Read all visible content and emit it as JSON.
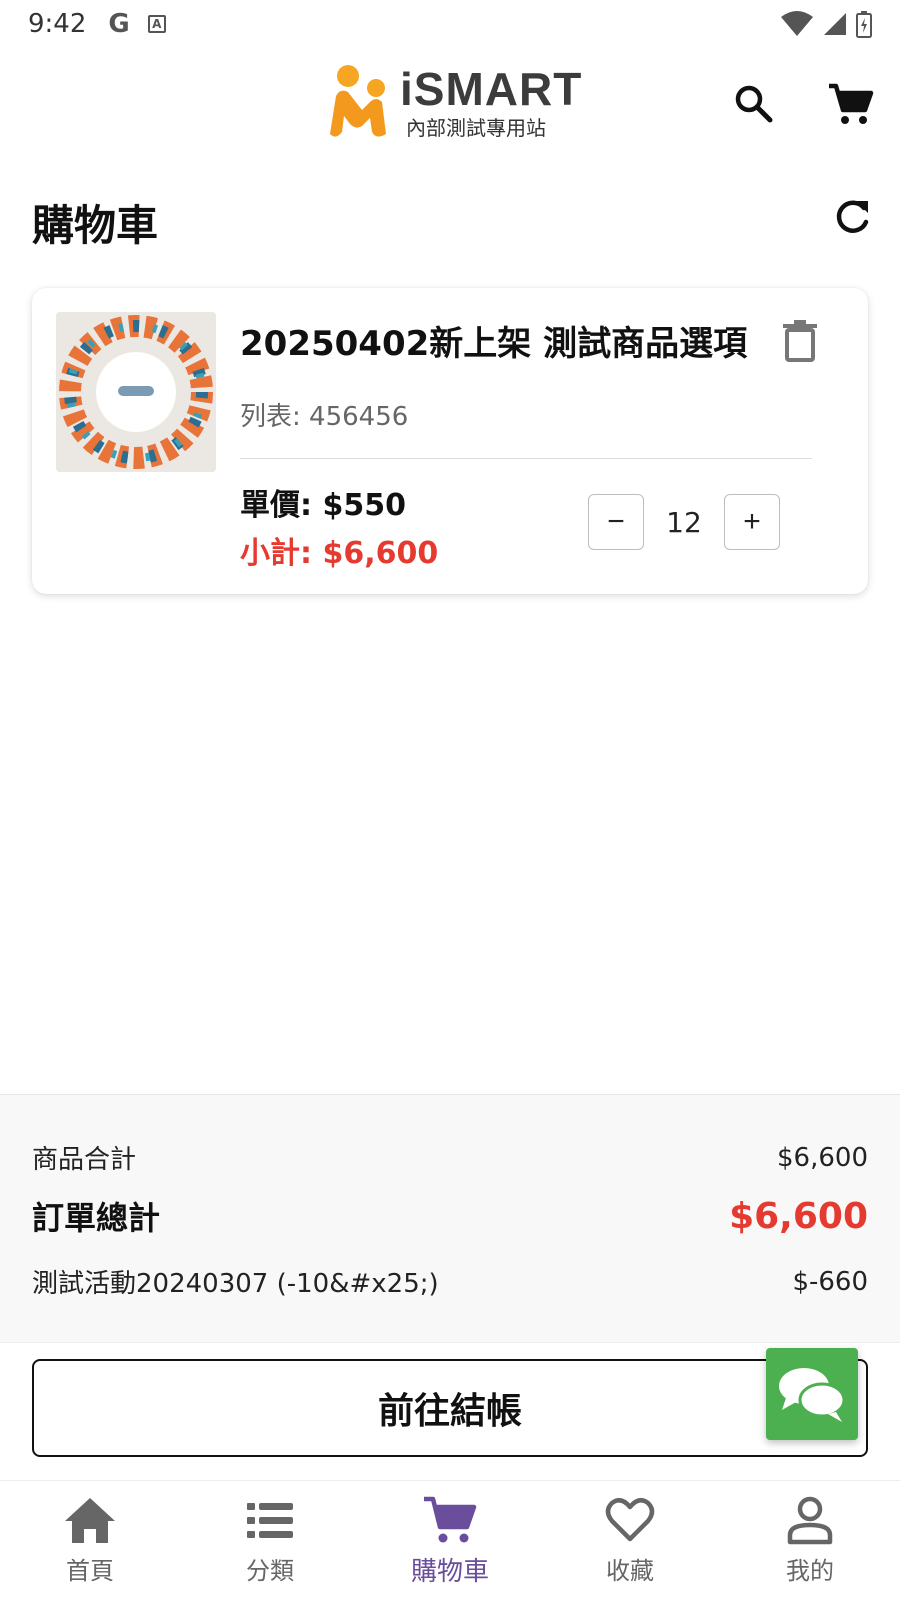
{
  "status_bar": {
    "time": "9:42",
    "left_icons": [
      "google-g-icon",
      "accessibility-a-icon"
    ],
    "right_icons": [
      "wifi-icon",
      "signal-icon",
      "battery-icon"
    ]
  },
  "header": {
    "logo_text": "iSMART",
    "logo_subtitle": "內部測試專用站",
    "icons": [
      "search-icon",
      "cart-icon"
    ]
  },
  "page": {
    "title": "購物車"
  },
  "cart": {
    "items": [
      {
        "name": "20250402新上架 測試商品選項",
        "variant": "列表: 456456",
        "unit_price": "單價: $550",
        "subtotal": "小計: $6,600",
        "quantity": "12",
        "minus_label": "−",
        "plus_label": "+"
      }
    ]
  },
  "summary": {
    "items_total_label": "商品合計",
    "items_total_value": "$6,600",
    "order_total_label": "訂單總計",
    "order_total_value": "$6,600",
    "discount_label": "測試活動20240307 (-10&#x25;)",
    "discount_value": "$-660"
  },
  "checkout": {
    "button_label": "前往結帳"
  },
  "bottom_nav": {
    "items": [
      {
        "label": "首頁",
        "icon": "home-icon"
      },
      {
        "label": "分類",
        "icon": "list-icon"
      },
      {
        "label": "購物車",
        "icon": "cart-icon"
      },
      {
        "label": "收藏",
        "icon": "heart-icon"
      },
      {
        "label": "我的",
        "icon": "person-icon"
      }
    ],
    "active_index": 2
  },
  "colors": {
    "accent_red": "#e53a2f",
    "nav_active": "#6a4e9b",
    "chat_green": "#4cb050",
    "logo_orange": "#f6a623"
  }
}
